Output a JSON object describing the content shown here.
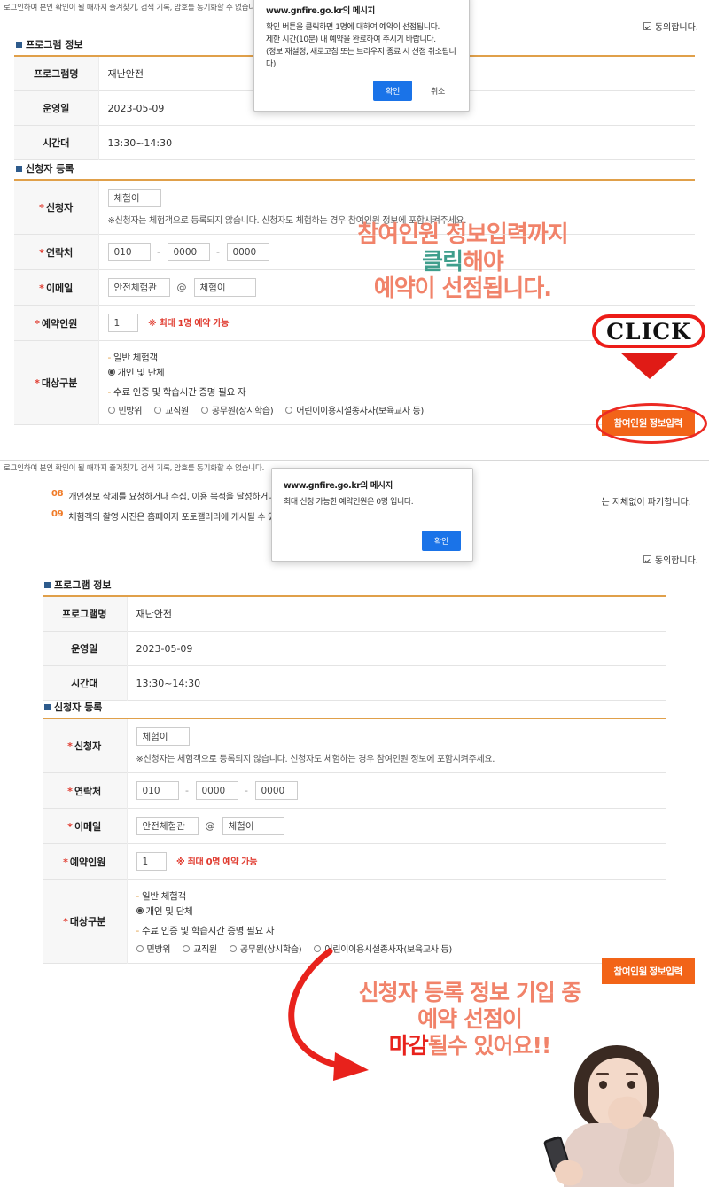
{
  "browser": {
    "sync_notice": "로그인하여 본인 확인이 될 때까지 즐겨찾기, 검색 기록, 암호를 동기화할 수 없습니다."
  },
  "dialog_top": {
    "title": "www.gnfire.go.kr의 메시지",
    "line1": "확인 버튼을 클릭하면 1명에 대하여 예약이 선점됩니다.",
    "line2": "제한 시간(10분) 내 예약을 완료하여 주시기 바랍니다.",
    "line3": "(정보 재설정, 새로고침 또는 브라우저 종료 시 선점 취소됩니다)",
    "ok_label": "확인",
    "cancel_label": "취소"
  },
  "dialog_bottom": {
    "title": "www.gnfire.go.kr의 메시지",
    "line1": "최대 신청 가능한 예약인원은 0명 입니다.",
    "ok_label": "확인"
  },
  "program_info": {
    "heading": "프로그램 정보",
    "rows": [
      {
        "label": "프로그램명",
        "value": "재난안전"
      },
      {
        "label": "운영일",
        "value": "2023-05-09"
      },
      {
        "label": "시간대",
        "value": "13:30~14:30"
      }
    ]
  },
  "applicant": {
    "heading": "신청자 등록",
    "name_label": "신청자",
    "name_value": "체험이",
    "name_note": "※신청자는 체험객으로 등록되지 않습니다. 신청자도 체험하는 경우 참여인원 정보에 포함시켜주세요.",
    "tel_label": "연락처",
    "tel1": "010",
    "tel2": "0000",
    "tel3": "0000",
    "tel_sep": "-",
    "email_label": "이메일",
    "email_id": "안전체험관",
    "email_at": "@",
    "email_domain": "체험이",
    "count_label": "예약인원",
    "count_value": "1",
    "count_note_top": "※ 최대 1명 예약 가능",
    "count_note_bottom": "※ 최대 0명 예약 가능",
    "target_label": "대상구분",
    "group_a_title": "일반 체험객",
    "group_a_option": "개인 및 단체",
    "group_b_title": "수료 인증 및 학습시간 증명 필요 자",
    "group_b_options": [
      "민방위",
      "교직원",
      "공무원(상시학습)",
      "어린이이용시설종사자(보육교사 등)"
    ]
  },
  "submit_button": {
    "label": "참여인원 정보입력"
  },
  "agreement": {
    "label": "동의합니다.",
    "checked": true
  },
  "privacy_items": [
    {
      "num": "08",
      "text": "개인정보 삭제를 요청하거나 수집, 이용 목적을 달성하거나 보유",
      "tail": "는 지체없이 파기합니다."
    },
    {
      "num": "09",
      "text": "체험객의 촬영 사진은 홈페이지 포토갤러리에 게시될 수 있으며",
      "tail": ""
    }
  ],
  "annotations": {
    "top": {
      "line1": "참여인원 정보입력까지",
      "line2_highlight": "클릭",
      "line2_rest": "해야",
      "line3": "예약이 선점됩니다."
    },
    "click_badge": "CLICK",
    "bottom": {
      "line1": "신청자 등록 정보 기입 중",
      "line2": "예약 선점이",
      "line3_highlight": "마감",
      "line3_rest": "될수 있어요!!"
    }
  },
  "colors": {
    "accent_orange": "#f26418",
    "table_rule": "#e0a04a",
    "annotation_salmon": "#f1836a",
    "annotation_teal": "#3f9e8c",
    "annotation_red": "#e8221c",
    "dialog_blue": "#1a73e8"
  }
}
